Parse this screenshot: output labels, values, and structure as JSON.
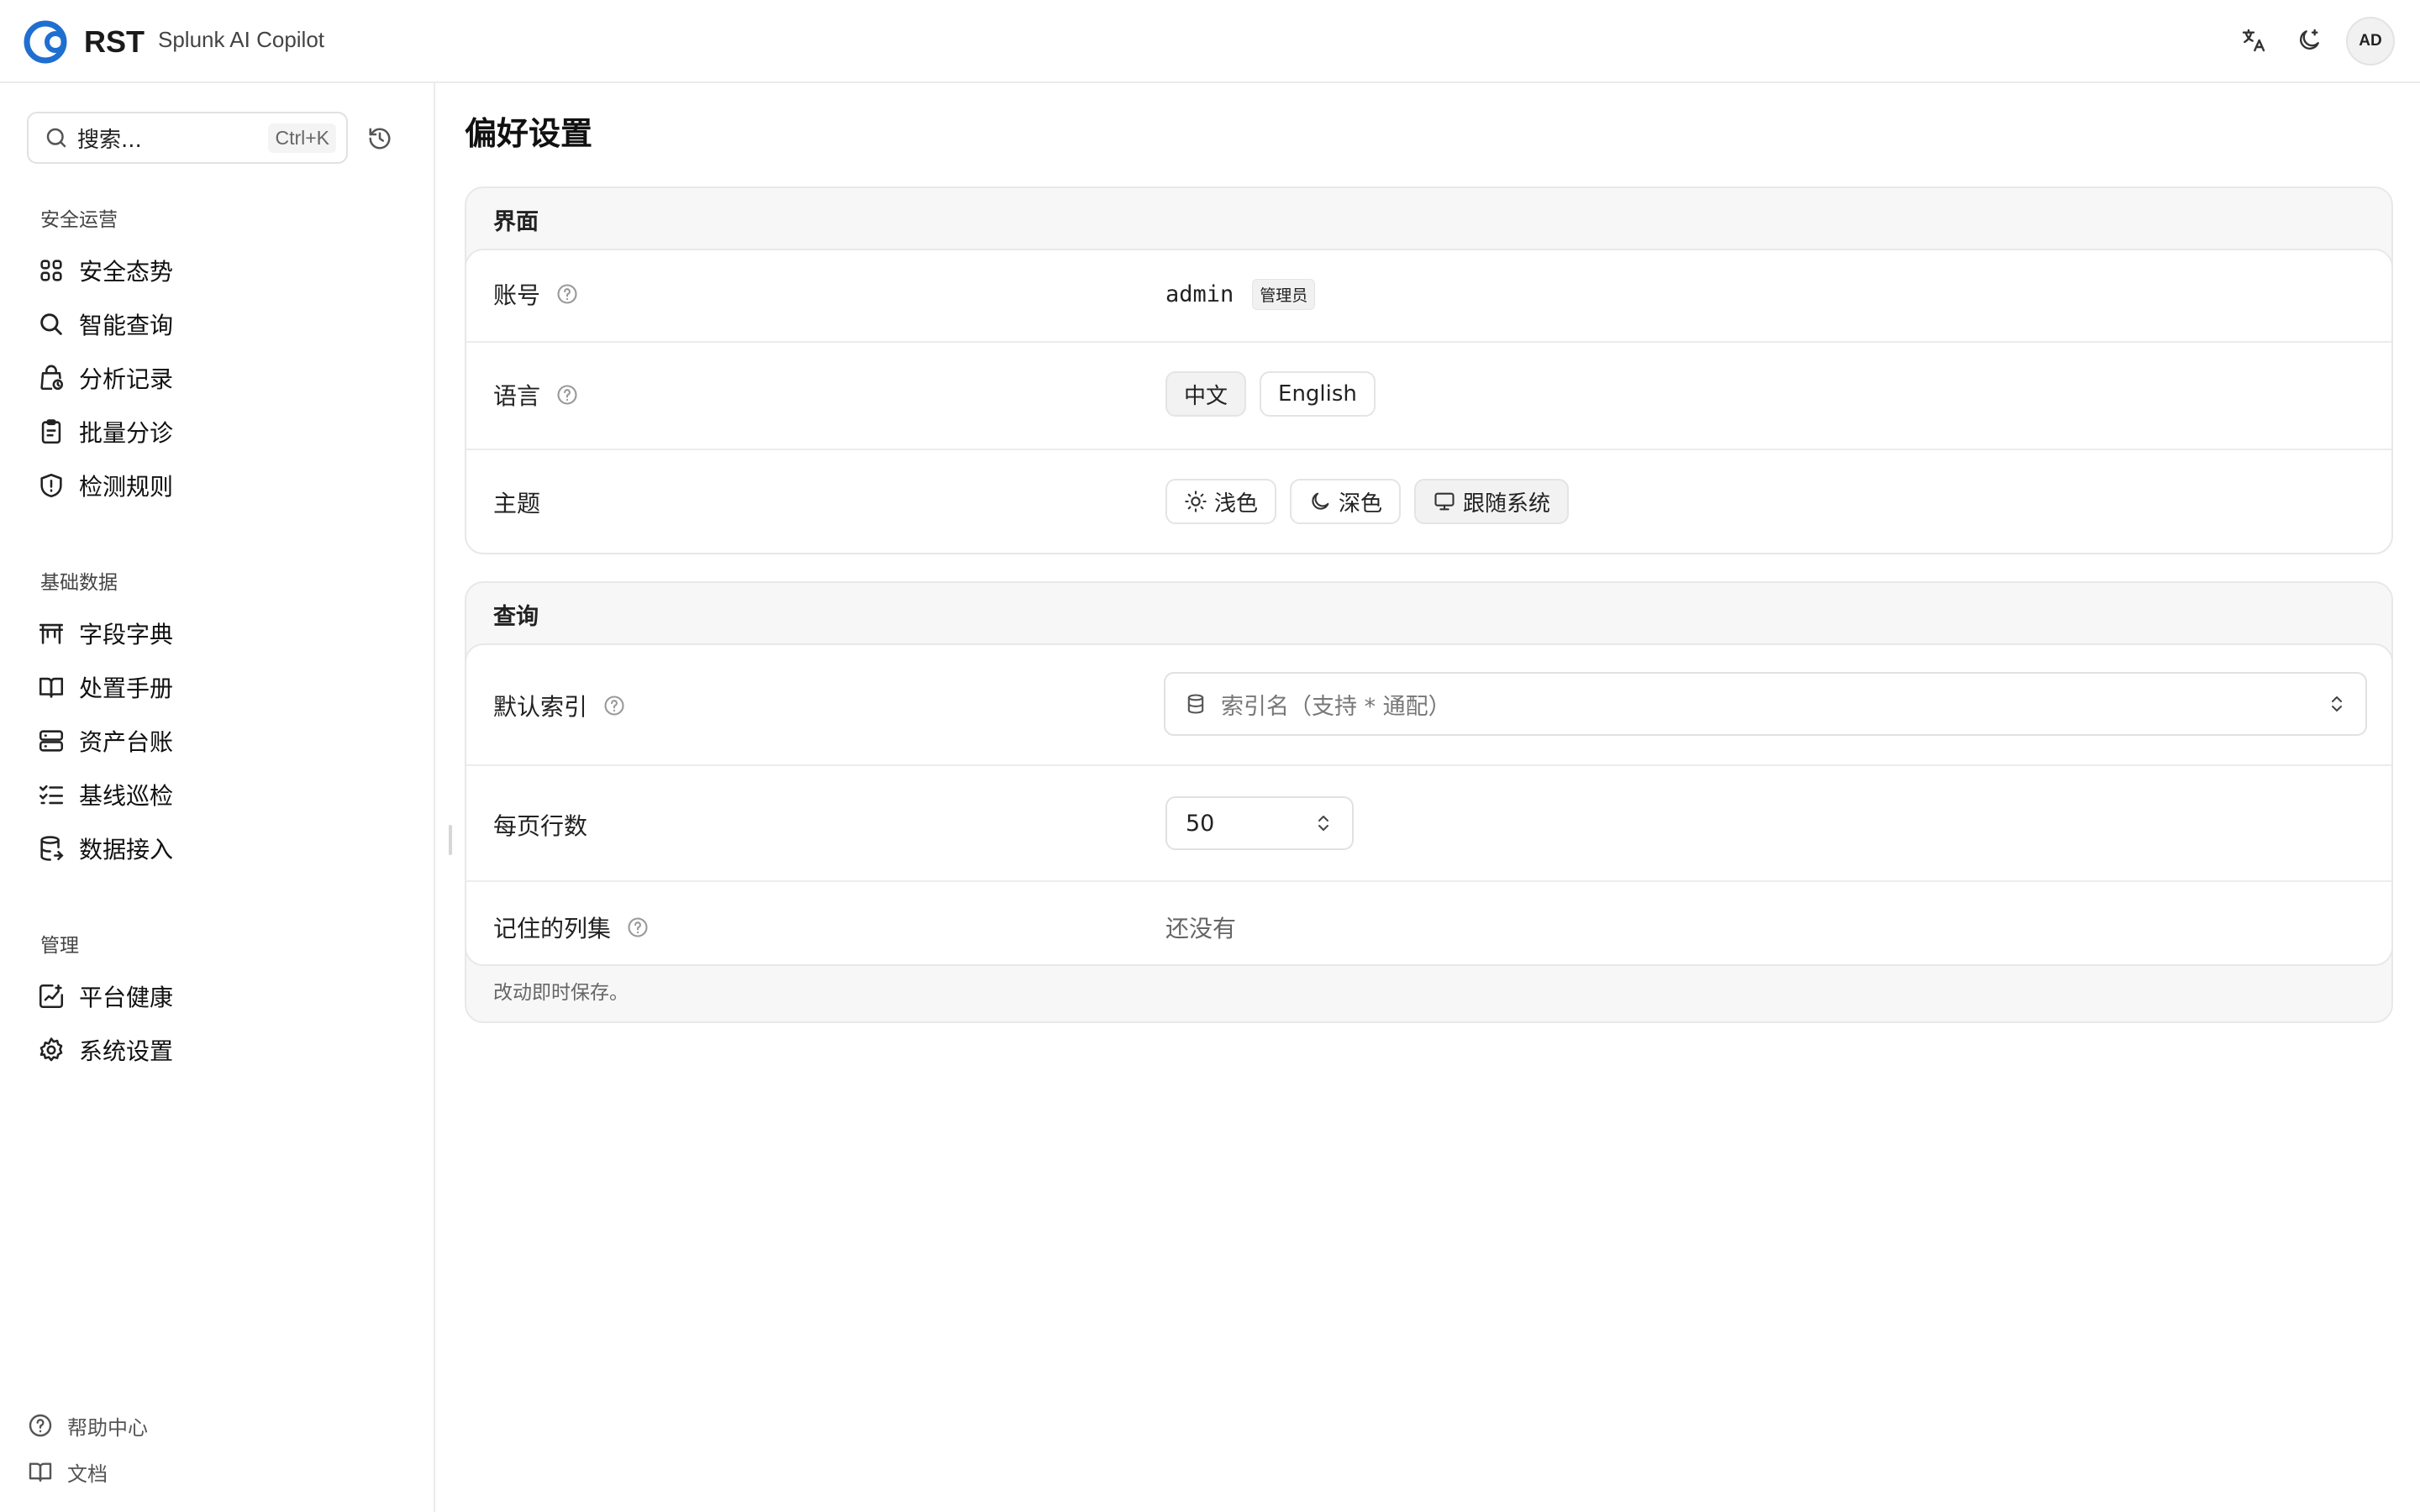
{
  "app": {
    "logo_text": "RST",
    "product_name": "Splunk AI Copilot",
    "avatar_initials": "AD"
  },
  "sidebar": {
    "search_placeholder": "搜索...",
    "search_shortcut": "Ctrl+K",
    "groups": [
      {
        "title": "安全运营",
        "items": [
          {
            "label": "安全态势",
            "icon": "dashboard-grid-icon"
          },
          {
            "label": "智能查询",
            "icon": "search-icon"
          },
          {
            "label": "分析记录",
            "icon": "history-bag-icon"
          },
          {
            "label": "批量分诊",
            "icon": "clipboard-icon"
          },
          {
            "label": "检测规则",
            "icon": "shield-alert-icon"
          }
        ]
      },
      {
        "title": "基础数据",
        "items": [
          {
            "label": "字段字典",
            "icon": "table-icon"
          },
          {
            "label": "处置手册",
            "icon": "book-open-icon"
          },
          {
            "label": "资产台账",
            "icon": "server-icon"
          },
          {
            "label": "基线巡检",
            "icon": "list-check-icon"
          },
          {
            "label": "数据接入",
            "icon": "database-import-icon"
          }
        ]
      },
      {
        "title": "管理",
        "items": [
          {
            "label": "平台健康",
            "icon": "health-chart-icon"
          },
          {
            "label": "系统设置",
            "icon": "gear-icon"
          }
        ]
      }
    ],
    "footer": [
      {
        "label": "帮助中心",
        "icon": "help-circle-icon"
      },
      {
        "label": "文档",
        "icon": "book-icon"
      }
    ]
  },
  "main": {
    "title": "偏好设置",
    "interface_card": {
      "title": "界面",
      "account_label": "账号",
      "account_value": "admin",
      "account_badge": "管理员",
      "language_label": "语言",
      "language_options": [
        "中文",
        "English"
      ],
      "language_selected": "中文",
      "theme_label": "主题",
      "theme_options": [
        "浅色",
        "深色",
        "跟随系统"
      ],
      "theme_selected": "跟随系统"
    },
    "query_card": {
      "title": "查询",
      "default_index_label": "默认索引",
      "default_index_placeholder": "索引名（支持 * 通配）",
      "rows_per_page_label": "每页行数",
      "rows_per_page_value": "50",
      "saved_columns_label": "记住的列集",
      "saved_columns_value": "还没有",
      "footer_note": "改动即时保存。"
    }
  }
}
